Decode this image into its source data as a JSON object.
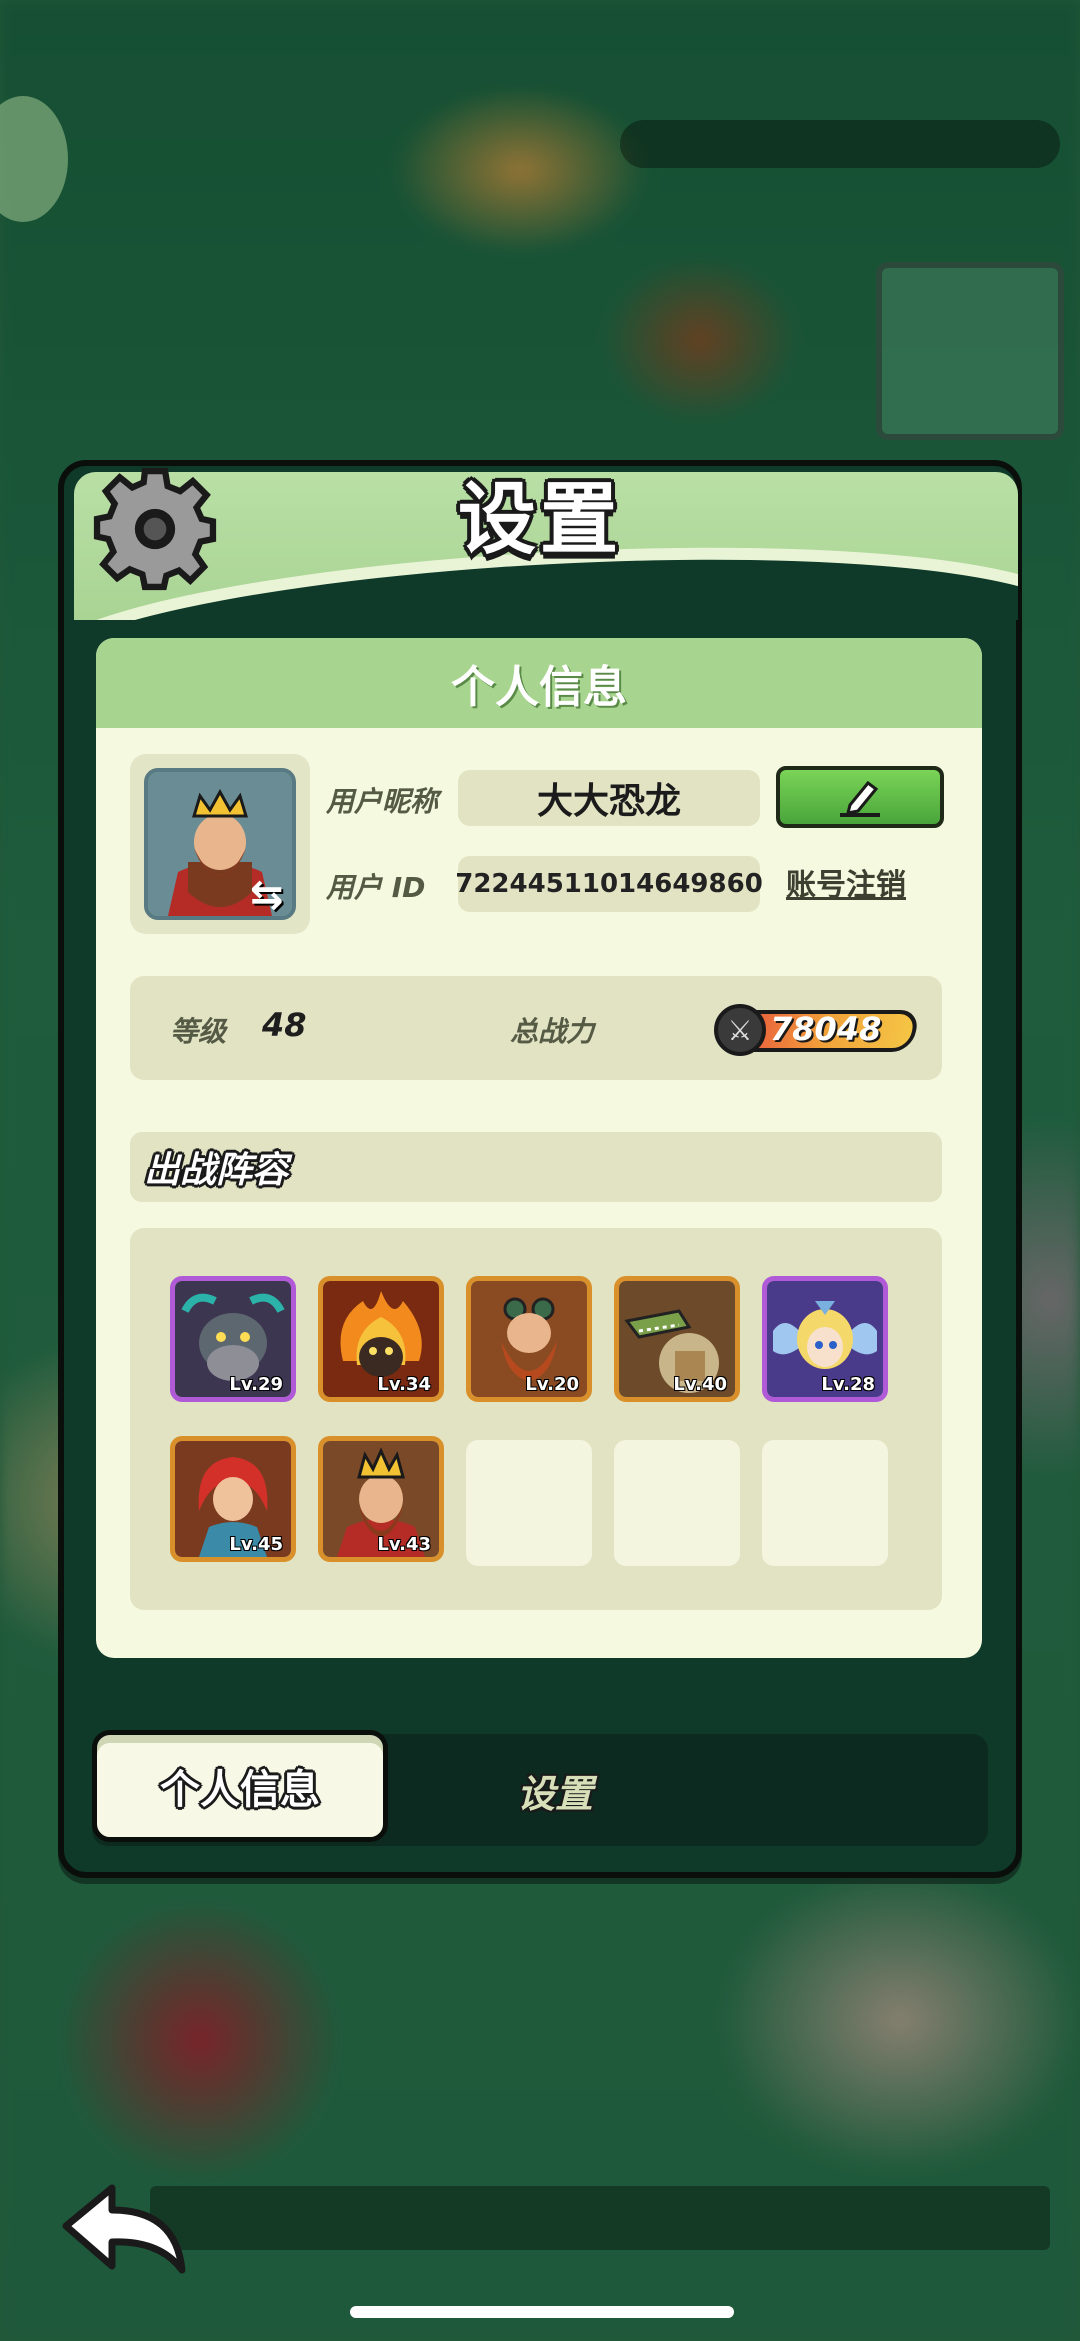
{
  "dialog": {
    "title": "设置",
    "gear_icon": "gear-icon"
  },
  "profile": {
    "section_title": "个人信息",
    "nickname_label": "用户昵称",
    "nickname_value": "大大恐龙",
    "id_label": "用户  ID",
    "id_value": "72244511014649860",
    "logout_label": "账号注销",
    "level_label": "等级",
    "level_value": "48",
    "power_label": "总战力",
    "power_value": "78048"
  },
  "lineup": {
    "title": "出战阵容",
    "heroes": [
      {
        "level": "Lv.29",
        "rarity": "purple"
      },
      {
        "level": "Lv.34",
        "rarity": "orange"
      },
      {
        "level": "Lv.20",
        "rarity": "orange"
      },
      {
        "level": "Lv.40",
        "rarity": "orange"
      },
      {
        "level": "Lv.28",
        "rarity": "purple"
      },
      {
        "level": "Lv.45",
        "rarity": "orange"
      },
      {
        "level": "Lv.43",
        "rarity": "orange"
      }
    ]
  },
  "tabs": {
    "profile": "个人信息",
    "settings": "设置"
  },
  "colors": {
    "accent_green": "#a7d48e",
    "panel_bg": "#f4f9df",
    "epic": "#b05ad8",
    "legendary": "#d9902a"
  }
}
